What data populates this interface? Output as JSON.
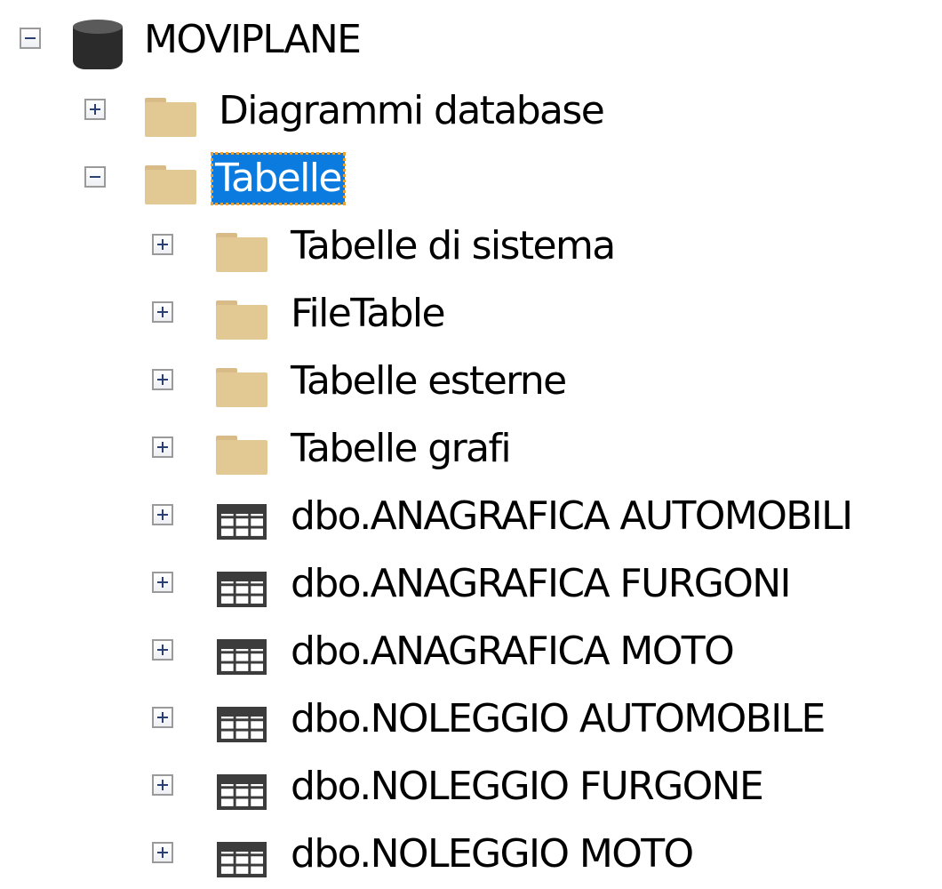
{
  "tree": {
    "database": {
      "label": "MOVIPLANE",
      "icon": "database-icon",
      "expanded": true
    },
    "children": [
      {
        "label": "Diagrammi database",
        "icon": "folder-icon",
        "expanded": false
      },
      {
        "label": "Tabelle",
        "icon": "folder-icon",
        "expanded": true,
        "selected": true
      }
    ],
    "tabelle_children": [
      {
        "label": "Tabelle di sistema",
        "icon": "folder-icon"
      },
      {
        "label": "FileTable",
        "icon": "folder-icon"
      },
      {
        "label": "Tabelle esterne",
        "icon": "folder-icon"
      },
      {
        "label": "Tabelle grafi",
        "icon": "folder-icon"
      },
      {
        "label": "dbo.ANAGRAFICA AUTOMOBILI",
        "icon": "table-icon"
      },
      {
        "label": "dbo.ANAGRAFICA FURGONI",
        "icon": "table-icon"
      },
      {
        "label": "dbo.ANAGRAFICA MOTO",
        "icon": "table-icon"
      },
      {
        "label": "dbo.NOLEGGIO AUTOMOBILE",
        "icon": "table-icon"
      },
      {
        "label": "dbo.NOLEGGIO FURGONE",
        "icon": "table-icon"
      },
      {
        "label": "dbo.NOLEGGIO MOTO",
        "icon": "table-icon"
      }
    ],
    "colors": {
      "selection": "#0c7be0",
      "folder": "#e2c994",
      "expander_sign": "#2a3f72"
    }
  }
}
